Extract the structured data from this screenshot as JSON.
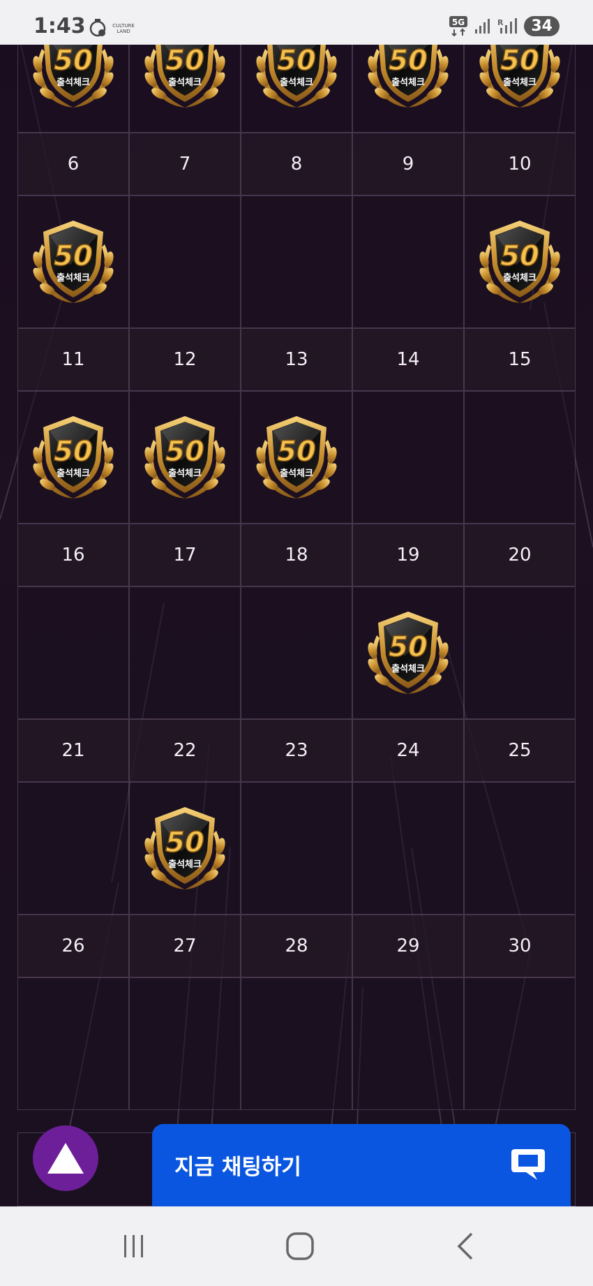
{
  "status_bar": {
    "time": "1:43",
    "app_badge_text": "CULTURE LAND",
    "network": "5G",
    "battery": "34"
  },
  "calendar": {
    "partial_top_row_badges": true,
    "days": [
      {
        "day": "6",
        "badge": true
      },
      {
        "day": "7",
        "badge": false
      },
      {
        "day": "8",
        "badge": false
      },
      {
        "day": "9",
        "badge": false
      },
      {
        "day": "10",
        "badge": true
      },
      {
        "day": "11",
        "badge": true
      },
      {
        "day": "12",
        "badge": true
      },
      {
        "day": "13",
        "badge": true
      },
      {
        "day": "14",
        "badge": false
      },
      {
        "day": "15",
        "badge": false
      },
      {
        "day": "16",
        "badge": false
      },
      {
        "day": "17",
        "badge": false
      },
      {
        "day": "18",
        "badge": false
      },
      {
        "day": "19",
        "badge": true
      },
      {
        "day": "20",
        "badge": false
      },
      {
        "day": "21",
        "badge": false
      },
      {
        "day": "22",
        "badge": true
      },
      {
        "day": "23",
        "badge": false
      },
      {
        "day": "24",
        "badge": false
      },
      {
        "day": "25",
        "badge": false
      },
      {
        "day": "26",
        "badge": false
      },
      {
        "day": "27",
        "badge": false
      },
      {
        "day": "28",
        "badge": false
      },
      {
        "day": "29",
        "badge": false
      },
      {
        "day": "30",
        "badge": false
      }
    ],
    "badge": {
      "number": "50",
      "label": "출석체크"
    }
  },
  "floating": {
    "scroll_top_icon": "triangle-up-icon",
    "chat_label": "지금 채팅하기",
    "chat_icon": "chat-bubble-icon"
  },
  "navbar": {
    "recent_icon": "recent-apps-icon",
    "home_icon": "home-icon",
    "back_icon": "back-icon"
  },
  "colors": {
    "accent_purple": "#6d1f99",
    "chat_blue": "#0a56e0",
    "badge_gold": "#d8a640"
  }
}
